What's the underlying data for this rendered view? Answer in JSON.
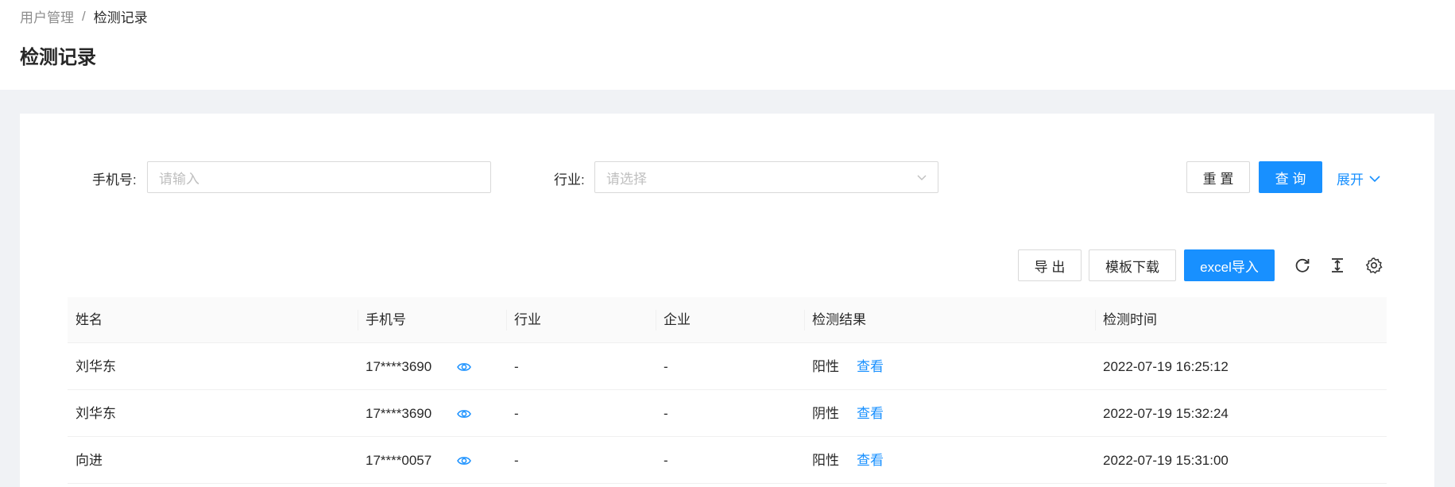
{
  "breadcrumb": {
    "parent": "用户管理",
    "separator": "/",
    "current": "检测记录"
  },
  "page_title": "检测记录",
  "filters": {
    "phone_label": "手机号:",
    "phone_placeholder": "请输入",
    "industry_label": "行业:",
    "industry_placeholder": "请选择",
    "reset_label": "重 置",
    "query_label": "查 询",
    "expand_label": "展开"
  },
  "toolbar": {
    "export_label": "导 出",
    "template_label": "模板下载",
    "import_label": "excel导入",
    "icons": [
      "reload-icon",
      "column-height-icon",
      "setting-icon"
    ]
  },
  "table": {
    "columns": [
      "姓名",
      "手机号",
      "行业",
      "企业",
      "检测结果",
      "检测时间"
    ],
    "rows": [
      {
        "name": "刘华东",
        "phone": "17****3690",
        "industry": "-",
        "company": "-",
        "result": "阳性",
        "action": "查看",
        "time": "2022-07-19 16:25:12"
      },
      {
        "name": "刘华东",
        "phone": "17****3690",
        "industry": "-",
        "company": "-",
        "result": "阴性",
        "action": "查看",
        "time": "2022-07-19 15:32:24"
      },
      {
        "name": "向进",
        "phone": "17****0057",
        "industry": "-",
        "company": "-",
        "result": "阳性",
        "action": "查看",
        "time": "2022-07-19 15:31:00"
      }
    ]
  },
  "colors": {
    "primary": "#1890ff",
    "background": "#f0f2f5"
  }
}
